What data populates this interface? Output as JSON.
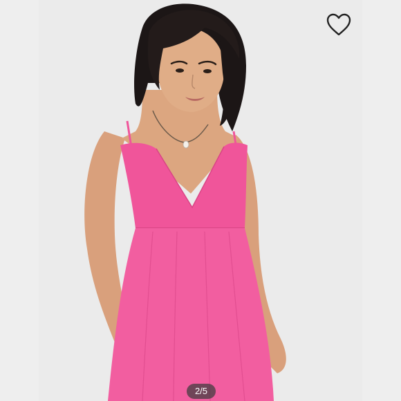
{
  "product_photo": {
    "alt": "",
    "favorite_icon": "heart-outline-icon",
    "image_counter": "2/5"
  },
  "colors": {
    "background": "#ebebeb",
    "dress": "#f0559a",
    "hair": "#1c1616",
    "skin": "#dca680"
  }
}
